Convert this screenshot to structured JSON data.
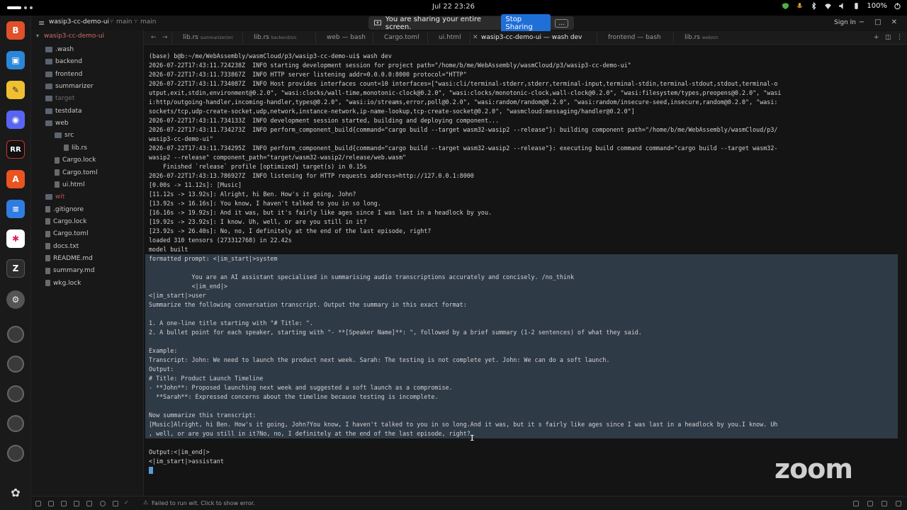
{
  "system": {
    "clock": "Jul 22  23:26",
    "battery": "100%"
  },
  "sharing": {
    "text": "You are sharing your entire screen.",
    "stop_label": "Stop Sharing",
    "more_label": "..."
  },
  "window": {
    "project": "wasip3-cc-demo-ui",
    "branch": "main",
    "branch2": "main",
    "sign_in": "Sign In"
  },
  "tree": {
    "root": "wasip3-cc-demo-ui",
    "items": [
      {
        "label": ".wash",
        "kind": "folder",
        "indent": 0
      },
      {
        "label": "backend",
        "kind": "folder",
        "indent": 0
      },
      {
        "label": "frontend",
        "kind": "folder",
        "indent": 0
      },
      {
        "label": "summarizer",
        "kind": "folder",
        "indent": 0
      },
      {
        "label": "target",
        "kind": "folder",
        "indent": 0
      },
      {
        "label": "testdata",
        "kind": "folder",
        "indent": 0
      },
      {
        "label": "web",
        "kind": "folder",
        "indent": 0
      },
      {
        "label": "src",
        "kind": "folder",
        "indent": 1
      },
      {
        "label": "lib.rs",
        "kind": "file",
        "indent": 2
      },
      {
        "label": "Cargo.lock",
        "kind": "file",
        "indent": 1
      },
      {
        "label": "Cargo.toml",
        "kind": "file",
        "indent": 1
      },
      {
        "label": "ui.html",
        "kind": "file",
        "indent": 1
      },
      {
        "label": "wit",
        "kind": "folder",
        "indent": 0
      },
      {
        "label": ".gitignore",
        "kind": "file",
        "indent": 0
      },
      {
        "label": "Cargo.lock",
        "kind": "file",
        "indent": 0
      },
      {
        "label": "Cargo.toml",
        "kind": "file",
        "indent": 0
      },
      {
        "label": "docs.txt",
        "kind": "file",
        "indent": 0
      },
      {
        "label": "README.md",
        "kind": "file",
        "indent": 0
      },
      {
        "label": "summary.md",
        "kind": "file",
        "indent": 0
      },
      {
        "label": "wkg.lock",
        "kind": "file",
        "indent": 0
      }
    ]
  },
  "tabs": [
    {
      "label": "lib.rs",
      "sub": "summarizer/src"
    },
    {
      "label": "lib.rs",
      "sub": "backend/src"
    },
    {
      "label": "web — bash",
      "sub": ""
    },
    {
      "label": "Cargo.toml",
      "sub": ""
    },
    {
      "label": "ui.html",
      "sub": ""
    },
    {
      "label": "wasip3-cc-demo-ui — wash dev",
      "sub": ""
    },
    {
      "label": "frontend — bash",
      "sub": ""
    },
    {
      "label": "lib.rs",
      "sub": "web/src"
    }
  ],
  "terminal": {
    "lines": [
      "(base) b@b:~/me/WebAssembly/wasmCloud/p3/wasip3-cc-demo-ui$ wash dev",
      "2026-07-22T17:43:11.724238Z  INFO starting development session for project path=\"/home/b/me/WebAssembly/wasmCloud/p3/wasip3-cc-demo-ui\"",
      "2026-07-22T17:43:11.733867Z  INFO HTTP server listening addr=0.0.0.0:8000 protocol=\"HTTP\"",
      "2026-07-22T17:43:11.734087Z  INFO Host provides interfaces count=10 interfaces=[\"wasi:cli/terminal-stderr,stderr,terminal-input,terminal-stdin,terminal-stdout,stdout,terminal-o",
      "utput,exit,stdin,environment@0.2.0\", \"wasi:clocks/wall-time,monotonic-clock@0.2.0\", \"wasi:clocks/monotonic-clock,wall-clock@0.2.0\", \"wasi:filesystem/types,preopens@0.2.0\", \"wasi",
      "i:http/outgoing-handler,incoming-handler,types@0.2.0\", \"wasi:io/streams,error,poll@0.2.0\", \"wasi:random/random@0.2.0\", \"wasi:random/insecure-seed,insecure,random@0.2.0\", \"wasi:",
      "sockets/tcp,udp-create-socket,udp,network,instance-network,ip-name-lookup,tcp-create-socket@0.2.0\", \"wasmcloud:messaging/handler@0.2.0\"]",
      "2026-07-22T17:43:11.734133Z  INFO development session started, building and deploying component...",
      "2026-07-22T17:43:11.734273Z  INFO perform_component_build{command=\"cargo build --target wasm32-wasip2 --release\"}: building component path=\"/home/b/me/WebAssembly/wasmCloud/p3/",
      "wasip3-cc-demo-ui\"",
      "2026-07-22T17:43:11.734295Z  INFO perform_component_build{command=\"cargo build --target wasm32-wasip2 --release\"}: executing build command command=\"cargo build --target wasm32-",
      "wasip2 --release\" component_path=\"target/wasm32-wasip2/release/web.wasm\"",
      "    Finished `release` profile [optimized] target(s) in 0.15s",
      "2026-07-22T17:43:13.786927Z  INFO listening for HTTP requests address=http://127.0.0.1:8000",
      "[0.00s -> 11.12s]: [Music]",
      "[11.12s -> 13.92s]: Alright, hi Ben. How's it going, John?",
      "[13.92s -> 16.16s]: You know, I haven't talked to you in so long.",
      "[16.16s -> 19.92s]: And it was, but it's fairly like ages since I was last in a headlock by you.",
      "[19.92s -> 23.92s]: I know. Uh, well, or are you still in it?",
      "[23.92s -> 26.40s]: No, no, I definitely at the end of the last episode, right?",
      "loaded 310 tensors (273312768) in 22.42s",
      "model built",
      "formatted prompt: <|im_start|>system",
      "",
      "            You are an AI assistant specialised in summarising audio transcriptions accurately and concisely. /no_think",
      "            <|im_end|>",
      "<|im_start|>user",
      "Summarize the following conversation transcript. Output the summary in this exact format:",
      "",
      "1. A one-line title starting with \"# Title: \".",
      "2. A bullet point for each speaker, starting with \"- **[Speaker Name]**: \", followed by a brief summary (1-2 sentences) of what they said.",
      "",
      "Example:",
      "Transcript: John: We need to launch the product next week. Sarah: The testing is not complete yet. John: We can do a soft launch.",
      "Output:",
      "# Title: Product Launch Timeline",
      "- **John**: Proposed launching next week and suggested a soft launch as a compromise.",
      "  **Sarah**: Expressed concerns about the timeline because testing is incomplete.",
      "",
      "Now summarize this transcript:",
      "[Music]Alright, hi Ben. How's it going, John?You know, I haven't talked to you in so long.And it was, but it s fairly like ages since I was last in a headlock by you.I know. Uh",
      ", well, or are you still in it?No, no, I definitely at the end of the last episode, right?",
      "",
      "Output:<|im_end|>",
      "<|im_start|>assistant"
    ]
  },
  "status": {
    "message": "Failed to run wit. Click to show error."
  },
  "watermark": "zoom"
}
